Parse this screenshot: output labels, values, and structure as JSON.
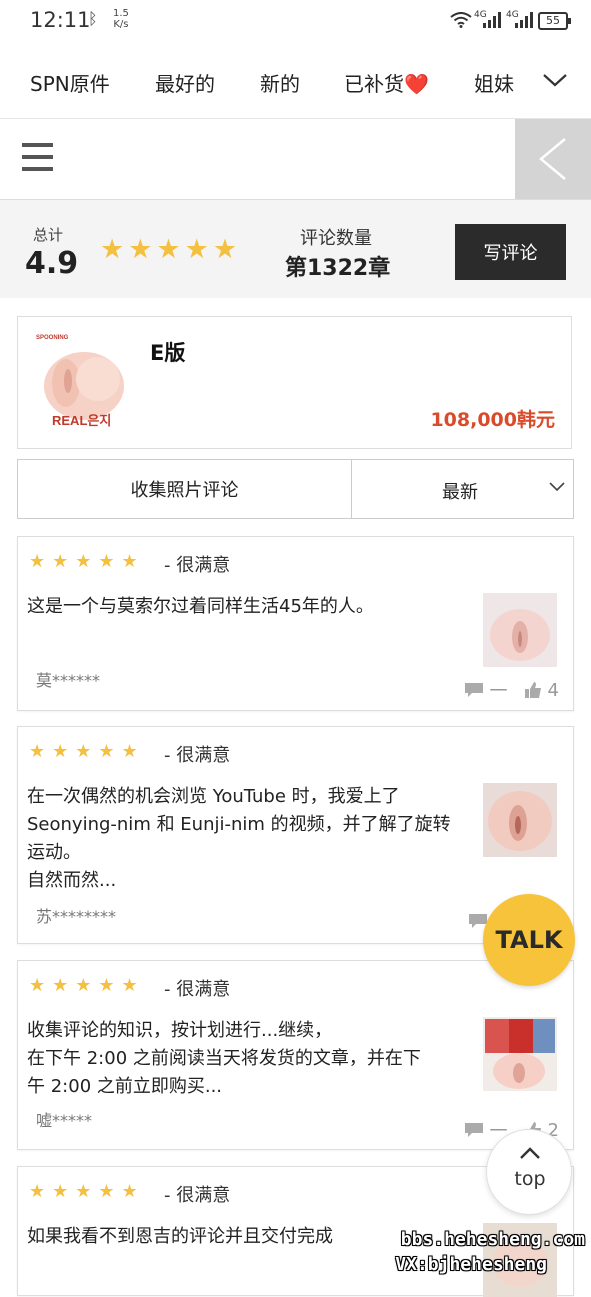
{
  "status_bar": {
    "time": "12:11",
    "net_speed_value": "1.5",
    "net_speed_unit": "K/s",
    "signal_1": "4G",
    "signal_2": "4G",
    "battery": "55"
  },
  "nav": {
    "items": [
      "SPN原件",
      "最好的",
      "新的",
      "已补货❤️",
      "姐妹"
    ]
  },
  "summary": {
    "total_label": "总计",
    "score": "4.9",
    "stars": "★★★★★",
    "count_label": "评论数量",
    "count_value": "第1322章",
    "write_button": "写评论"
  },
  "product": {
    "image_brand": "SPOONING",
    "image_caption": "REAL은지",
    "name": "E版",
    "price": "108,000韩元"
  },
  "filters": {
    "photo_reviews": "收集照片评论",
    "sort": "最新"
  },
  "reviews": [
    {
      "stars": "★★★★★",
      "rating_text": "- 很满意",
      "lines": [
        "这是一个与莫索尔过着同样生活45年的人。"
      ],
      "user": "莫******",
      "comments": "一",
      "likes": "4"
    },
    {
      "stars": "★★★★★",
      "rating_text": "- 很满意",
      "lines": [
        "在一次偶然的机会浏览 YouTube 时，我爱上了",
        "Seonying-nim 和 Eunji-nim 的视频，并了解了旋转",
        "运动。",
        "自然而然..."
      ],
      "user": "苏********",
      "comments": "",
      "likes": ""
    },
    {
      "stars": "★★★★★",
      "rating_text": "- 很满意",
      "lines": [
        "收集评论的知识，按计划进行...继续，",
        "在下午 2:00 之前阅读当天将发货的文章，并在下",
        "午 2:00 之前立即购买..."
      ],
      "user": "嘘*****",
      "comments": "一",
      "likes": "2"
    },
    {
      "stars": "★★★★★",
      "rating_text": "- 很满意",
      "lines": [
        "如果我看不到恩吉的评论并且交付完成"
      ],
      "user": "",
      "comments": "",
      "likes": ""
    }
  ],
  "floating": {
    "talk": "TALK",
    "top": "top"
  },
  "watermark": {
    "line1": "bbs.hehesheng.com",
    "line2": "VX:bjhehesheng"
  },
  "colors": {
    "star": "#f4c042",
    "price": "#d94b2b",
    "talk_bg": "#f6c33a",
    "write_btn_bg": "#2b2b2b"
  }
}
